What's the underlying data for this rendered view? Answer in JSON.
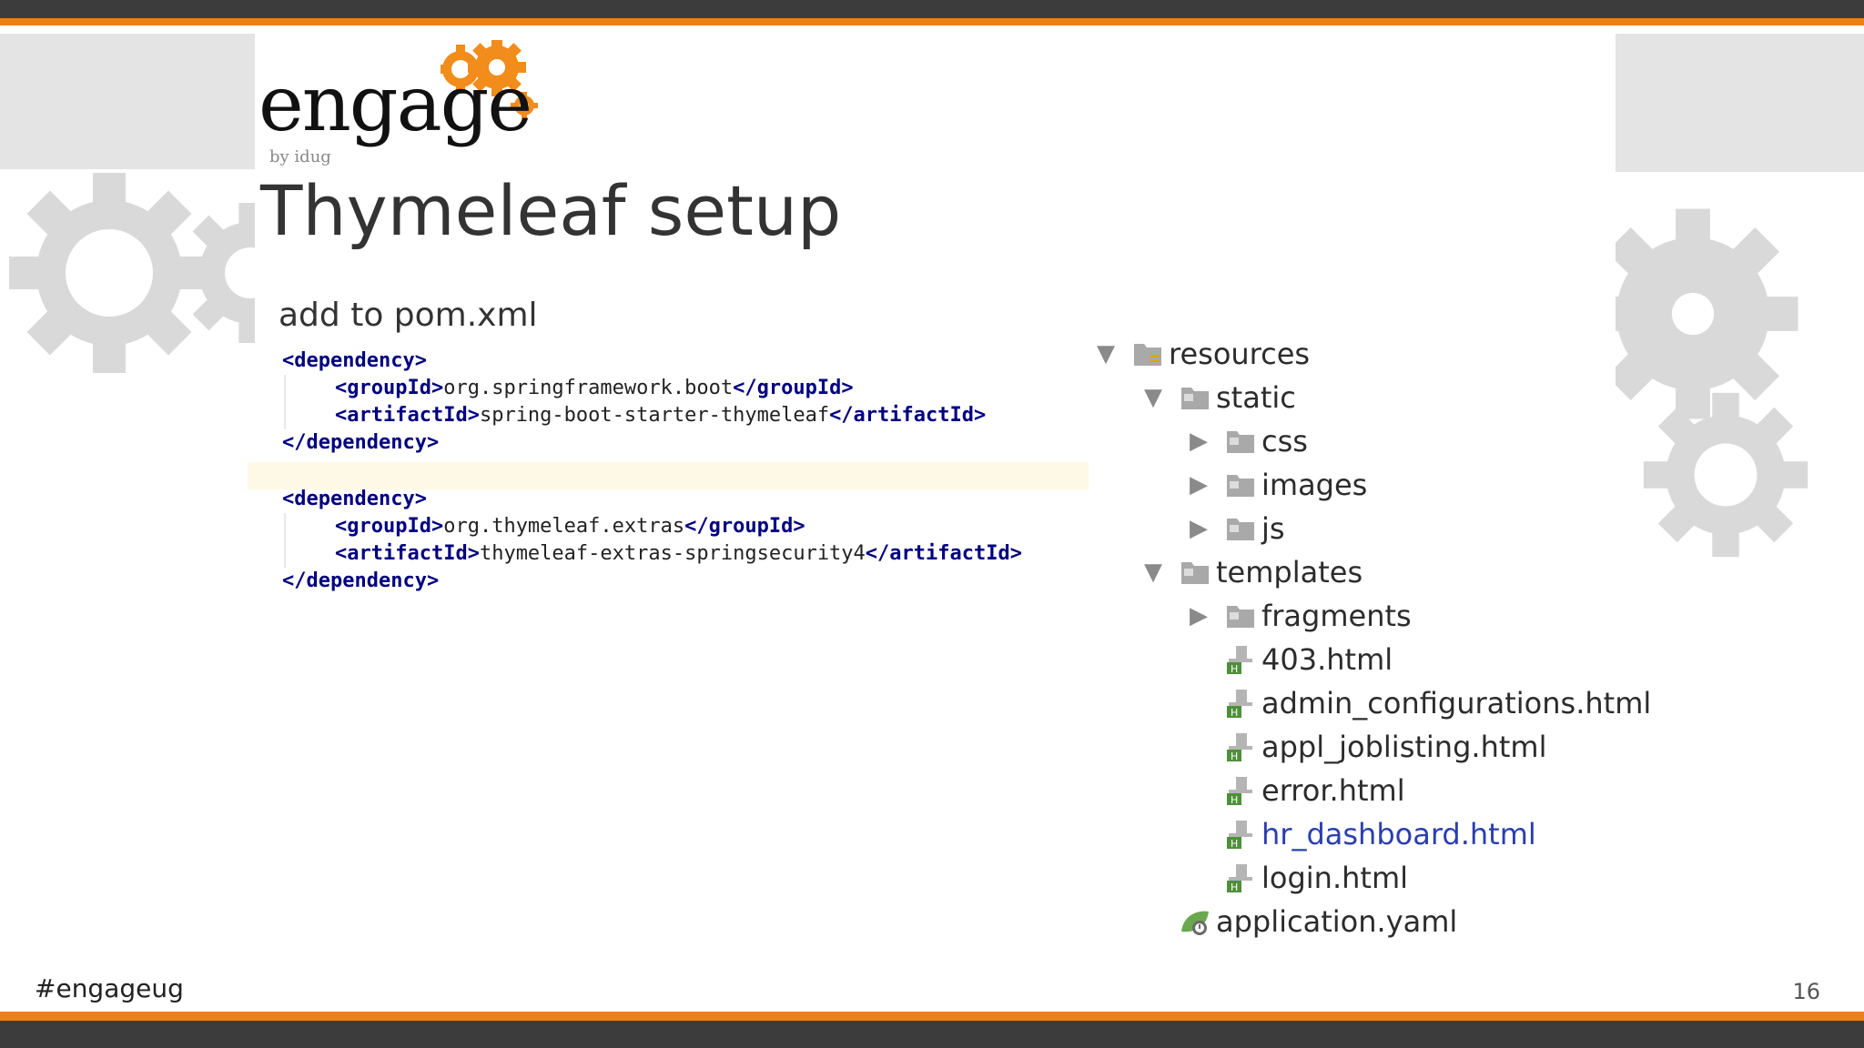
{
  "logo": {
    "word": "engage",
    "byline": "by idug"
  },
  "slide": {
    "title": "Thymeleaf setup",
    "subtitle": "add to pom.xml",
    "hashtag": "#engageug",
    "page_number": "16"
  },
  "code": {
    "block1": {
      "open": "<dependency>",
      "group_open": "<groupId>",
      "group_value": "org.springframework.boot",
      "group_close": "</groupId>",
      "artifact_open": "<artifactId>",
      "artifact_value": "spring-boot-starter-thymeleaf",
      "artifact_close": "</artifactId>",
      "close": "</dependency>"
    },
    "block2": {
      "open": "<dependency>",
      "group_open": "<groupId>",
      "group_value": "org.thymeleaf.extras",
      "group_close": "</groupId>",
      "artifact_open": "<artifactId>",
      "artifact_value": "thymeleaf-extras-springsecurity4",
      "artifact_close": "</artifactId>",
      "close": "</dependency>"
    }
  },
  "tree": {
    "resources": "resources",
    "static": "static",
    "css": "css",
    "images": "images",
    "js": "js",
    "templates": "templates",
    "fragments": "fragments",
    "f403": "403.html",
    "admin": "admin_configurations.html",
    "appl": "appl_joblisting.html",
    "error": "error.html",
    "hr": "hr_dashboard.html",
    "login": "login.html",
    "yaml": "application.yaml",
    "expanded_arrow": "▼",
    "collapsed_arrow": "▶"
  },
  "colors": {
    "accent_orange": "#f07f1a",
    "bar_dark": "#3c3c3c",
    "gear_gray": "#d9d9d9",
    "xml_tag": "#000080",
    "link_blue": "#2a3eb1"
  }
}
